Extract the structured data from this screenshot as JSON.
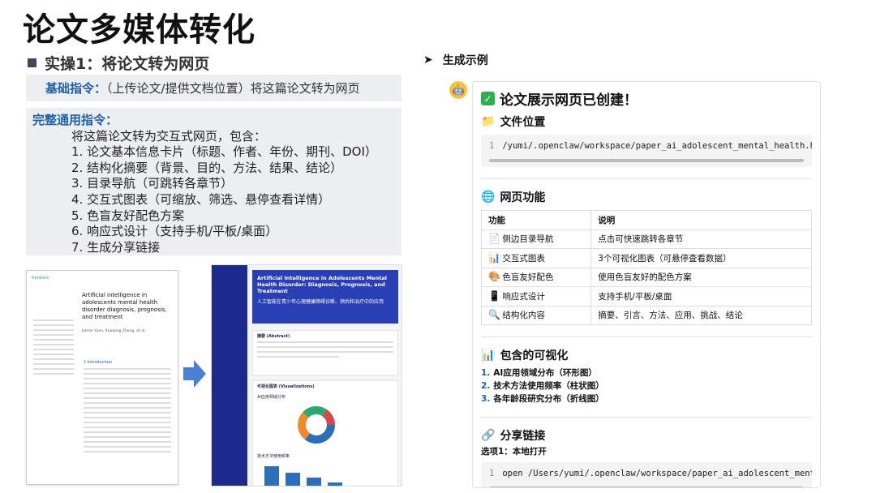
{
  "slide": {
    "main_title": "论文多媒体转化",
    "section_heading": "实操1：将论文转为网页",
    "basic_label": "基础指令：",
    "basic_text": "（上传论文/提供文档位置）将这篇论文转为网页",
    "full_label": "完整通用指令：",
    "full_intro": "将这篇论文转为交互式网页，包含：",
    "full_items": [
      "1. 论文基本信息卡片（标题、作者、年份、期刊、DOI）",
      "2. 结构化摘要（背景、目的、方法、结果、结论）",
      "3. 目录导航（可跳转各章节）",
      "4. 交互式图表（可缩放、筛选、悬停查看详情）",
      "5. 色盲友好配色方案",
      "6. 响应式设计（支持手机/平板/桌面）",
      "7. 生成分享链接"
    ],
    "sample_heading": "生成示例"
  },
  "paper_thumb": {
    "publisher": "frontiers",
    "title": "Artificial intelligence in adolescents mental health disorder diagnosis, prognosis, and treatment",
    "authors": "Jiamin Yuan, Xiaobing Zheng, et al.",
    "section": "1 Introduction"
  },
  "web_thumb": {
    "title_en": "Artificial Intelligence in Adolescents Mental Health Disorder: Diagnosis, Prognosis, and Treatment",
    "title_zh": "人工智能在青少年心理健康障碍诊断、预后和治疗中的应用",
    "abstract_label": "摘要 (Abstract)",
    "viz_label": "可视化图表 (Visualizations)",
    "chart1_label": "AI应用领域分布",
    "chart2_label": "技术方法使用频率"
  },
  "panel": {
    "created_title": "论文展示网页已创建！",
    "file_location_label": "文件位置",
    "file_path": "/yumi/.openclaw/workspace/paper_ai_adolescent_mental_health.html",
    "features_label": "网页功能",
    "table_headers": [
      "功能",
      "说明"
    ],
    "features": [
      {
        "icon": "sidebar-icon",
        "name": "侧边目录导航",
        "desc": "点击可快速跳转各章节"
      },
      {
        "icon": "bar-chart-icon",
        "name": "交互式图表",
        "desc": "3个可视化图表（可悬停查看数据）"
      },
      {
        "icon": "palette-icon",
        "name": "色盲友好配色",
        "desc": "使用色盲友好的配色方案"
      },
      {
        "icon": "phone-icon",
        "name": "响应式设计",
        "desc": "支持手机/平板/桌面"
      },
      {
        "icon": "magnifier-icon",
        "name": "结构化内容",
        "desc": "摘要、引言、方法、应用、挑战、结论"
      }
    ],
    "viz_label": "包含的可视化",
    "viz_items": [
      "AI应用领域分布（环形图）",
      "技术方法使用频率（柱状图）",
      "各年龄段研究分布（折线图）"
    ],
    "share_label": "分享链接",
    "option_label": "选项1：本地打开",
    "share_cmd": "open /Users/yumi/.openclaw/workspace/paper_ai_adolescent_mental_"
  },
  "colors": {
    "accent": "#1f5fa6",
    "web_navy": "#1b2a8c",
    "check_green": "#2eb04f"
  }
}
